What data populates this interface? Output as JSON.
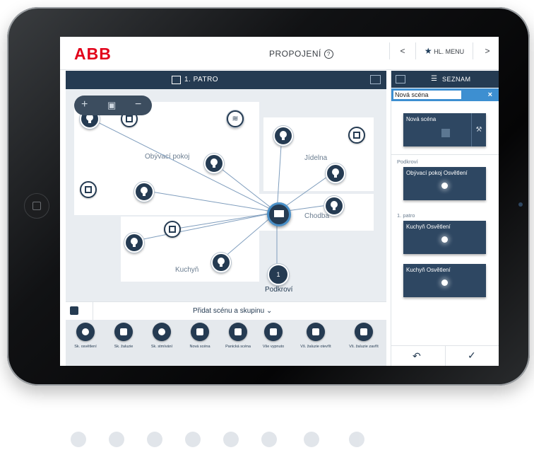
{
  "header": {
    "logo": "ABB",
    "title": "PROPOJENÍ",
    "help_icon": "?",
    "nav_prev": "<",
    "nav_menu": "HL. MENU",
    "nav_next": ">"
  },
  "floor_bar": {
    "label": "1. PATRO"
  },
  "rooms": {
    "living": "Obývací pokoj",
    "dining": "Jídelna",
    "hallway": "Chodba",
    "kitchen": "Kuchyň"
  },
  "zoom": {
    "plus": "+",
    "fit": "▣",
    "minus": "−"
  },
  "scene_node": {
    "badge": "1",
    "label": "Podkroví"
  },
  "add_bar": {
    "label": "Přidat scénu a skupinu ⌄"
  },
  "palette": [
    {
      "label": "Sk. osvětlení",
      "icon": "bulb-icon"
    },
    {
      "label": "Sk. žaluzie",
      "icon": "blind-icon"
    },
    {
      "label": "Sk. stmívání",
      "icon": "dimmer-icon"
    },
    {
      "label": "Nová scéna",
      "icon": "scene-icon"
    },
    {
      "label": "Panická scéna",
      "icon": "scene-icon"
    },
    {
      "label": "Vše vypnuto",
      "icon": "scene-icon"
    },
    {
      "label": "Vš. žaluzie otevřít",
      "icon": "scene-icon"
    },
    {
      "label": "Vš. žaluzie zavřít",
      "icon": "scene-icon"
    }
  ],
  "panel": {
    "title": "SEZNAM",
    "search_value": "Nová scéna",
    "clear": "×",
    "new_scene_card": "Nová scéna",
    "group_attic": "Podkroví",
    "card_living": "Obývací pokoj Osvětlení",
    "group_first": "1. patro",
    "card_kitchen_1": "Kuchyň Osvětlení",
    "card_kitchen_2": "Kuchyň Osvětlení",
    "undo": "↶",
    "confirm": "✓"
  },
  "colors": {
    "navy": "#253b52",
    "accent_blue": "#3d8fd1",
    "abb_red": "#e2001a"
  }
}
